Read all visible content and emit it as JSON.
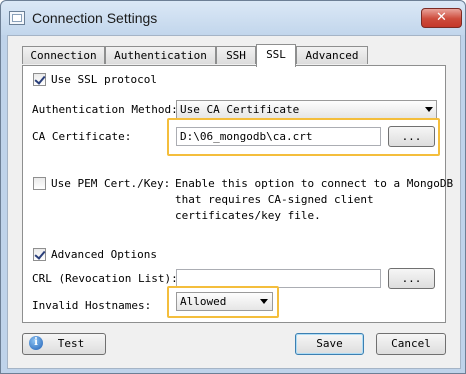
{
  "window": {
    "title": "Connection Settings",
    "close_label": "✕"
  },
  "tabs": [
    {
      "label": "Connection"
    },
    {
      "label": "Authentication"
    },
    {
      "label": "SSH"
    },
    {
      "label": "SSL"
    },
    {
      "label": "Advanced"
    }
  ],
  "ssl": {
    "use_ssl_label": "Use SSL protocol",
    "auth_method_label": "Authentication Method:",
    "auth_method_value": "Use CA Certificate",
    "ca_cert_label": "CA Certificate:",
    "ca_cert_value": "D:\\06_mongodb\\ca.crt",
    "browse_label": "...",
    "use_pem_label": "Use PEM Cert./Key:",
    "pem_help_line1": "Enable this option to connect to a MongoDB",
    "pem_help_line2": "that requires CA-signed client",
    "pem_help_line3": "certificates/key file.",
    "advanced_options_label": "Advanced Options",
    "crl_label": "CRL (Revocation List):",
    "crl_value": "",
    "invalid_hostnames_label": "Invalid Hostnames:",
    "invalid_hostnames_value": "Allowed"
  },
  "footer": {
    "test_label": "Test",
    "save_label": "Save",
    "cancel_label": "Cancel"
  },
  "colors": {
    "highlight": "#f4be3c",
    "title_bar": "#c2d6ec",
    "close_button": "#c4382a"
  }
}
